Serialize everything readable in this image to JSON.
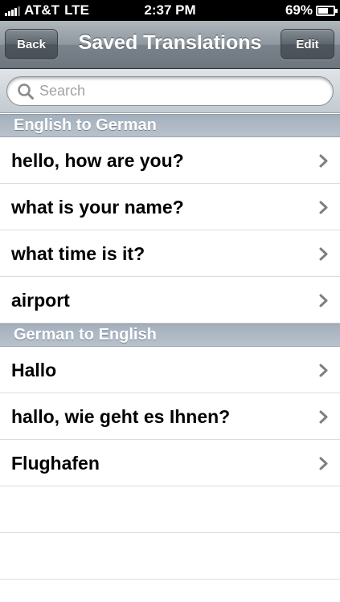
{
  "status_bar": {
    "carrier": "AT&T",
    "network": "LTE",
    "time": "2:37 PM",
    "battery": "69%",
    "battery_level": 0.69
  },
  "nav": {
    "back_label": "Back",
    "title": "Saved Translations",
    "edit_label": "Edit"
  },
  "search": {
    "placeholder": "Search"
  },
  "sections": [
    {
      "header": "English to German",
      "items": [
        "hello, how are you?",
        "what is your name?",
        "what time is it?",
        "airport"
      ]
    },
    {
      "header": "German to English",
      "items": [
        "Hallo",
        "hallo, wie geht es Ihnen?",
        "Flughafen"
      ]
    }
  ]
}
